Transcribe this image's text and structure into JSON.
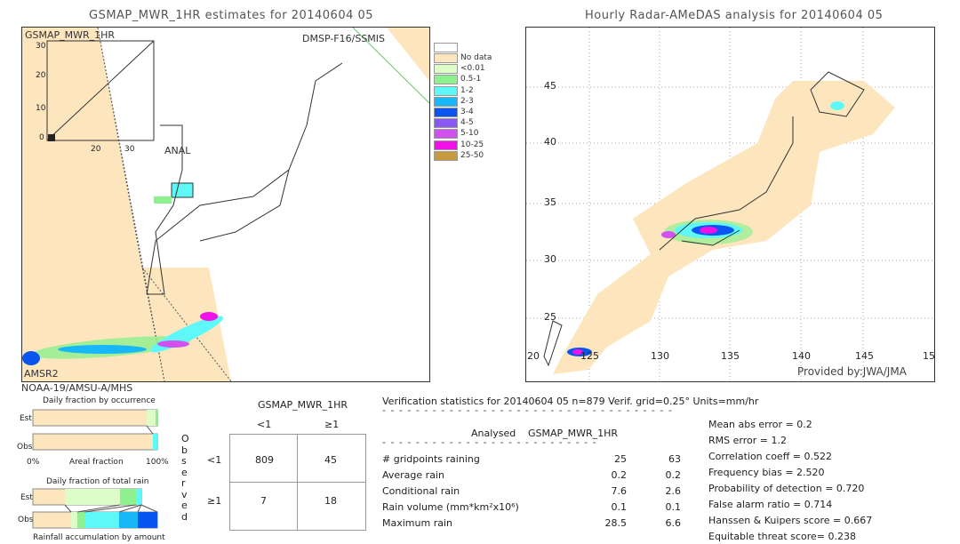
{
  "left_map": {
    "title": "GSMAP_MWR_1HR estimates for 20140604 05",
    "label_product": "GSMAP_MWR_1HR",
    "label_sensor_top": "DMSP-F16/SSMIS",
    "label_anal": "ANAL",
    "label_amsr": "AMSR2",
    "label_below": "NOAA-19/AMSU-A/MHS",
    "inset_ticks_y": [
      "30",
      "20",
      "10",
      "0"
    ],
    "inset_ticks_x": [
      "20",
      "30"
    ]
  },
  "right_map": {
    "title": "Hourly Radar-AMeDAS analysis for 20140604 05",
    "lat_ticks": [
      "45",
      "40",
      "35",
      "30",
      "25",
      "20"
    ],
    "lon_ticks": [
      "125",
      "130",
      "135",
      "140",
      "145",
      "15"
    ],
    "credit": "Provided by:JWA/JMA"
  },
  "legend": {
    "items": [
      {
        "label": "No data",
        "color": "#fde6be"
      },
      {
        "label": "<0.01",
        "color": "#dcfcc8"
      },
      {
        "label": "0.5-1",
        "color": "#8ef08e"
      },
      {
        "label": "1-2",
        "color": "#5ef8f8"
      },
      {
        "label": "2-3",
        "color": "#18b8f8"
      },
      {
        "label": "3-4",
        "color": "#0a55f0"
      },
      {
        "label": "4-5",
        "color": "#8a5af0"
      },
      {
        "label": "5-10",
        "color": "#d050f0"
      },
      {
        "label": "10-25",
        "color": "#f010e8"
      },
      {
        "label": "25-50",
        "color": "#c89a40"
      }
    ]
  },
  "fraction_charts": {
    "occurrence_title": "Daily fraction by occurrence",
    "est": "Est",
    "obs": "Obs",
    "axis_left": "0%",
    "axis_mid": "Areal fraction",
    "axis_right": "100%",
    "total_title": "Daily fraction of total rain",
    "accum_title": "Rainfall accumulation by amount"
  },
  "contingency": {
    "title": "GSMAP_MWR_1HR",
    "col_lt": "<1",
    "col_ge": "≥1",
    "row_lt": "<1",
    "row_ge": "≥1",
    "observed": "Observed",
    "cells": [
      "809",
      "45",
      "7",
      "18"
    ]
  },
  "stats": {
    "header": "Verification statistics for 20140604 05   n=879   Verif. grid=0.25°   Units=mm/hr",
    "col_analysed": "Analysed",
    "col_product": "GSMAP_MWR_1HR",
    "rows": [
      {
        "label": "# gridpoints raining",
        "a": "25",
        "b": "63"
      },
      {
        "label": "Average rain",
        "a": "0.2",
        "b": "0.2"
      },
      {
        "label": "Conditional rain",
        "a": "7.6",
        "b": "2.6"
      },
      {
        "label": "Rain volume (mm*km²x10⁶)",
        "a": "0.1",
        "b": "0.1"
      },
      {
        "label": "Maximum rain",
        "a": "28.5",
        "b": "6.6"
      }
    ],
    "scores": [
      "Mean abs error = 0.2",
      "RMS error = 1.2",
      "Correlation coeff = 0.522",
      "Frequency bias = 2.520",
      "Probability of detection = 0.720",
      "False alarm ratio = 0.714",
      "Hanssen & Kuipers score = 0.667",
      "Equitable threat score= 0.238"
    ]
  }
}
